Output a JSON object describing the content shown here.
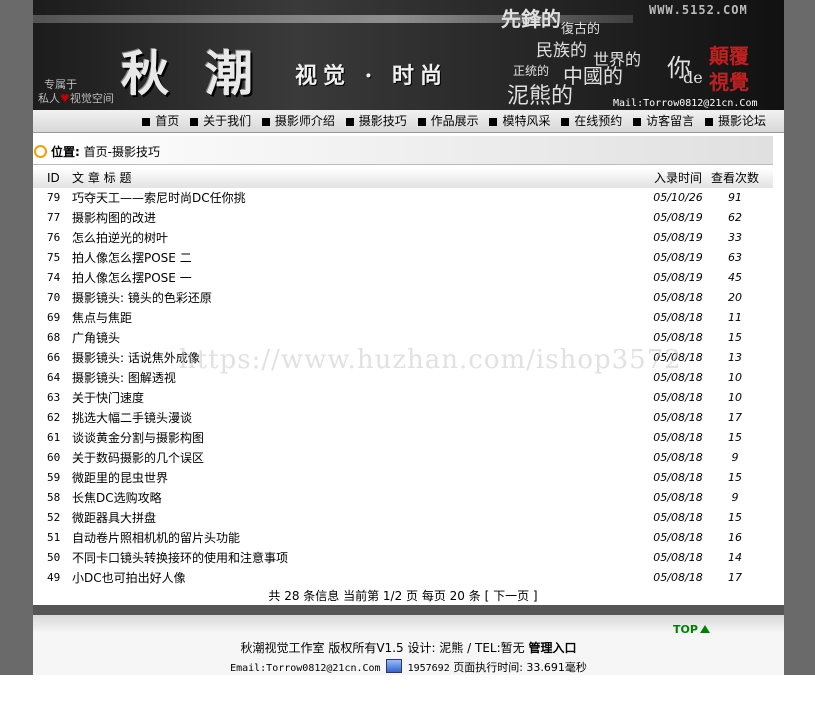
{
  "banner": {
    "logo_chars": [
      "秋",
      "潮"
    ],
    "logo_sub": "视觉 · 时尚",
    "slogan_line1": "专属于",
    "slogan_line2_a": "私人",
    "slogan_line2_b": "视觉空间",
    "site_url": "WWW.5152.COM",
    "poem": [
      "先鋒的",
      "復古的",
      "民族的",
      "世界的",
      "正统的",
      "中國的",
      "泥熊的",
      "你",
      "de"
    ],
    "red_words": [
      "顛覆",
      "視覺"
    ],
    "mail": "Mail:Torrow0812@21cn.Com"
  },
  "nav": {
    "items": [
      "首页",
      "关于我们",
      "摄影师介绍",
      "摄影技巧",
      "作品展示",
      "模特风采",
      "在线预约",
      "访客留言",
      "摄影论坛"
    ]
  },
  "location": {
    "label": "位置:",
    "path": "首页-摄影技巧"
  },
  "table": {
    "headers": {
      "id": "ID",
      "title": "文 章 标 题",
      "date": "入录时间",
      "views": "查看次数"
    },
    "rows": [
      {
        "id": "79",
        "title": "巧夺天工——索尼时尚DC任你挑",
        "date": "05/10/26",
        "views": "91"
      },
      {
        "id": "77",
        "title": "摄影构图的改进",
        "date": "05/08/19",
        "views": "62"
      },
      {
        "id": "76",
        "title": "怎么拍逆光的树叶",
        "date": "05/08/19",
        "views": "33"
      },
      {
        "id": "75",
        "title": "拍人像怎么摆POSE 二",
        "date": "05/08/19",
        "views": "63"
      },
      {
        "id": "74",
        "title": "拍人像怎么摆POSE 一",
        "date": "05/08/19",
        "views": "45"
      },
      {
        "id": "70",
        "title": "摄影镜头: 镜头的色彩还原",
        "date": "05/08/18",
        "views": "20"
      },
      {
        "id": "69",
        "title": "焦点与焦距",
        "date": "05/08/18",
        "views": "11"
      },
      {
        "id": "68",
        "title": "广角镜头",
        "date": "05/08/18",
        "views": "15"
      },
      {
        "id": "66",
        "title": "摄影镜头: 话说焦外成像",
        "date": "05/08/18",
        "views": "13"
      },
      {
        "id": "64",
        "title": "摄影镜头: 图解透视",
        "date": "05/08/18",
        "views": "10"
      },
      {
        "id": "63",
        "title": "关于快门速度",
        "date": "05/08/18",
        "views": "10"
      },
      {
        "id": "62",
        "title": "挑选大幅二手镜头漫谈",
        "date": "05/08/18",
        "views": "17"
      },
      {
        "id": "61",
        "title": "谈谈黄金分割与摄影构图",
        "date": "05/08/18",
        "views": "15"
      },
      {
        "id": "60",
        "title": "关于数码摄影的几个误区",
        "date": "05/08/18",
        "views": "9"
      },
      {
        "id": "59",
        "title": "微距里的昆虫世界",
        "date": "05/08/18",
        "views": "15"
      },
      {
        "id": "58",
        "title": "长焦DC选购攻略",
        "date": "05/08/18",
        "views": "9"
      },
      {
        "id": "52",
        "title": "微距器具大拼盘",
        "date": "05/08/18",
        "views": "15"
      },
      {
        "id": "51",
        "title": "自动卷片照相机机的留片头功能",
        "date": "05/08/18",
        "views": "16"
      },
      {
        "id": "50",
        "title": "不同卡口镜头转换接环的使用和注意事项",
        "date": "05/08/18",
        "views": "14"
      },
      {
        "id": "49",
        "title": "小DC也可拍出好人像",
        "date": "05/08/18",
        "views": "17"
      }
    ]
  },
  "pager": {
    "text": "共 28 条信息 当前第 1/2 页 每页 20 条 [ ",
    "next": "下一页",
    "close": " ]"
  },
  "watermark": "https://www.huzhan.com/ishop3572",
  "footer": {
    "top": "TOP",
    "line1": "秋潮视觉工作室 版权所有V1.5 设计: 泥熊 / TEL:暂无 ",
    "admin": "管理入口",
    "email": "Email:Torrow0812@21cn.Com",
    "counter": "1957692",
    "exec": "页面执行时间: 33.691毫秒"
  }
}
